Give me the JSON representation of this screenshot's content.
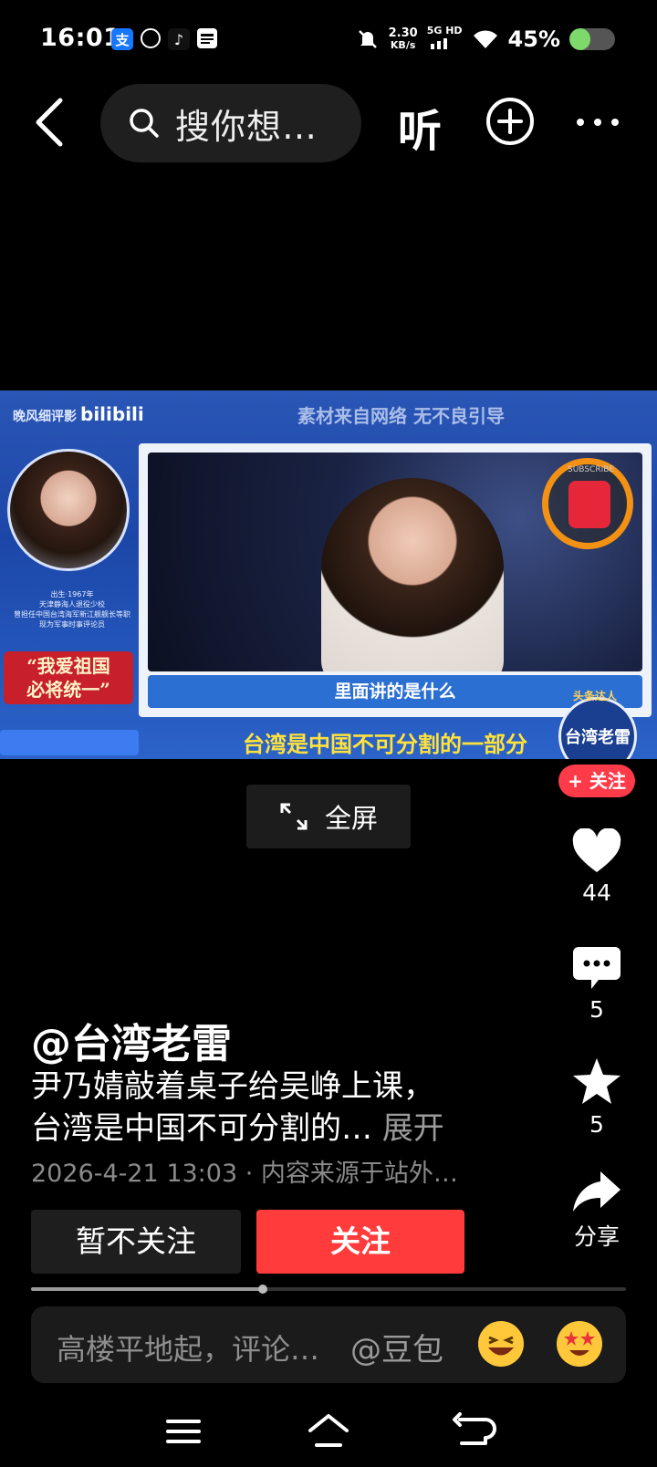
{
  "status_bar": {
    "time": "16:01",
    "app_icons": [
      "alipay-icon",
      "app-icon",
      "tiktok-icon",
      "news-icon"
    ],
    "net_speed_value": "2.30",
    "net_speed_unit": "KB/s",
    "network": "5G HD",
    "battery_percent_label": "45%",
    "battery_level": 0.45
  },
  "nav": {
    "search_placeholder": "搜你想…",
    "listen_label": "听"
  },
  "video": {
    "brand_text": "晚风细评影",
    "brand_logo": "bilibili",
    "top_note": "素材来自网络 无不良引导",
    "bio_lines": [
      "出生·1967年",
      "天津静海人退役少校",
      "曾担任中国台湾海军新江舰舰长等职",
      "现为军事时事评论员"
    ],
    "slogan_line1": "“我爱祖国",
    "slogan_line2": "必将统一”",
    "subscribe_text": "SUBSCRIBE",
    "caption": "里面讲的是什么",
    "banner": "台湾是中国不可分割的一部分",
    "logo_top": "头条达人",
    "logo_text": "台湾老雷"
  },
  "follow_badge": "+ 关注",
  "fullscreen_label": "全屏",
  "actions": {
    "likes": "44",
    "comments": "5",
    "favorites": "5",
    "share_label": "分享"
  },
  "post": {
    "author": "@台湾老雷",
    "desc_line1": "尹乃婧敲着桌子给吴峥上课，",
    "desc_line2": "台湾是中国不可分割的…",
    "expand_label": "展开",
    "meta": "2026-4-21 13:03 · 内容来源于站外…"
  },
  "buttons": {
    "unfollow": "暂不关注",
    "follow": "关注"
  },
  "progress": 0.39,
  "comment": {
    "placeholder": "高楼平地起，评论…",
    "mention": "@豆包"
  },
  "colors": {
    "accent_red": "#ff3b3b",
    "video_blue": "#1c47a8",
    "banner_yellow": "#ffe23b"
  }
}
